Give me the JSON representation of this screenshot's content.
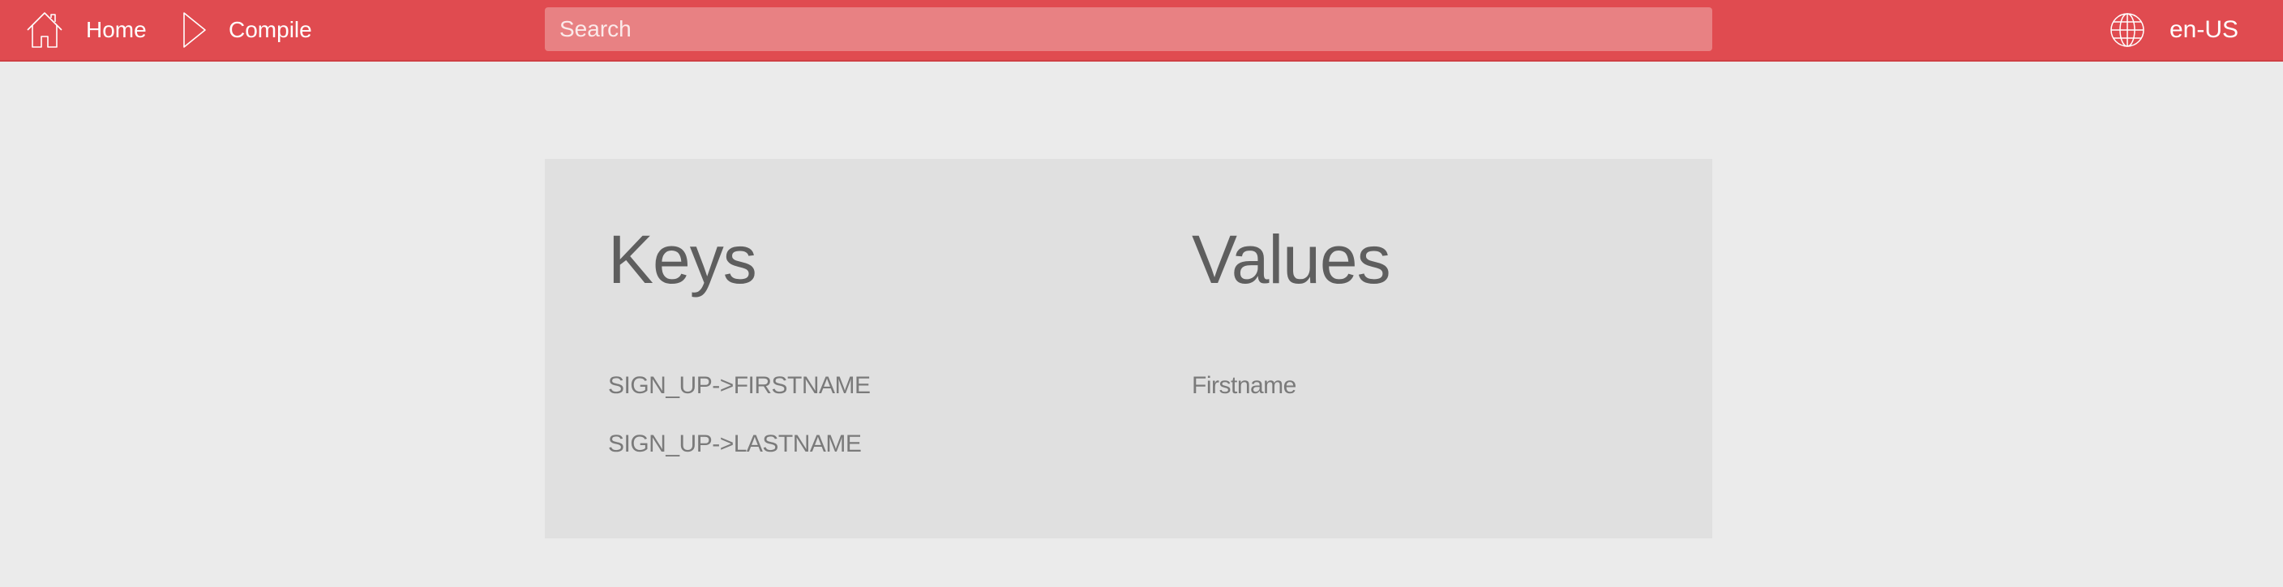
{
  "nav": {
    "home_label": "Home",
    "compile_label": "Compile"
  },
  "search": {
    "placeholder": "Search",
    "value": ""
  },
  "language": {
    "label": "en-US"
  },
  "table": {
    "keys_title": "Keys",
    "values_title": "Values",
    "keys": [
      "SIGN_UP->FIRSTNAME",
      "SIGN_UP->LASTNAME"
    ],
    "values": [
      "Firstname",
      ""
    ]
  },
  "icons": {
    "home": "home-icon",
    "compile": "play-icon",
    "language": "globe-icon"
  },
  "colors": {
    "accent": "#e04b50",
    "background": "#ebebeb",
    "panel": "#e0e0e0"
  }
}
